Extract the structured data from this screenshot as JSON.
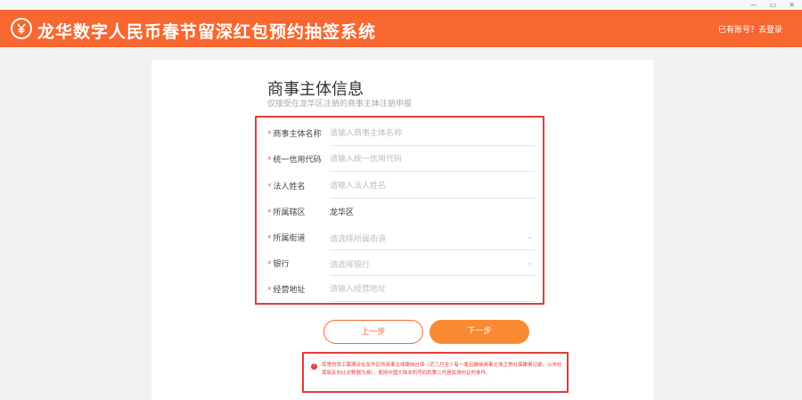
{
  "window": {
    "controls": [
      "—",
      "▭",
      "✕"
    ]
  },
  "header": {
    "logo_icon": "yuan-coin-icon",
    "title": "龙华数字人民币春节留深红包预约抽签系统",
    "login_link": "已有账号？去登录",
    "color": "#f7672f"
  },
  "form": {
    "title": "商事主体信息",
    "subtitle": "仅接受在龙华区注册的商事主体注册申报",
    "fields": [
      {
        "label": "商事主体名称",
        "placeholder": "请输入商事主体名称",
        "type": "text"
      },
      {
        "label": "统一信用代码",
        "placeholder": "请输入统一信用代码",
        "type": "text"
      },
      {
        "label": "法人姓名",
        "placeholder": "请输入法人姓名",
        "type": "text"
      },
      {
        "label": "所属辖区",
        "value": "龙华区",
        "type": "static"
      },
      {
        "label": "所属街道",
        "placeholder": "请选择所属街道",
        "type": "select"
      },
      {
        "label": "银行",
        "placeholder": "请选择银行",
        "type": "select"
      },
      {
        "label": "经营地址",
        "placeholder": "请输入经营地址",
        "type": "text"
      }
    ],
    "required_mark": "*",
    "prev_button": "上一步",
    "next_button": "下一步",
    "notice": "库里的员工需满足在龙华区的商事主体缴纳社保（近三月至少有一笔且缴纳商事主体正常社保缴费记录，以市社保局反向比对数据为准），使用中国大陆本机号码和第二代居民身份证的条件。"
  },
  "colors": {
    "accent": "#f7672f",
    "button_gradient": "#f98a33",
    "highlight_border": "#e23b3b"
  }
}
